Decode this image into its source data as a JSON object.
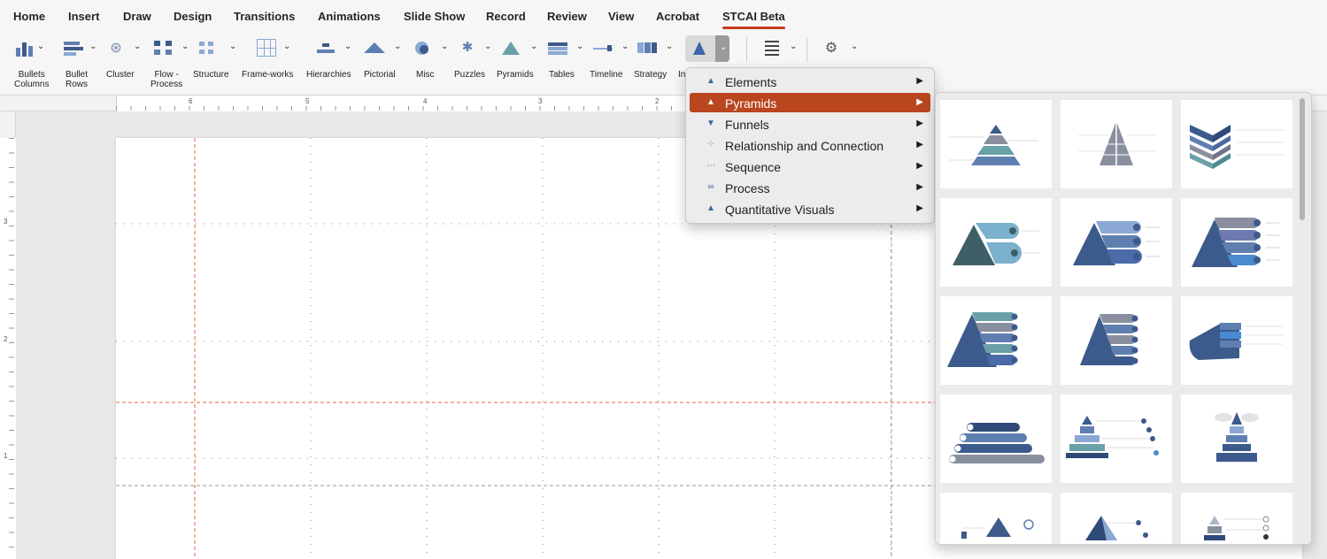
{
  "tabs": [
    {
      "label": "Home"
    },
    {
      "label": "Insert"
    },
    {
      "label": "Draw"
    },
    {
      "label": "Design"
    },
    {
      "label": "Transitions"
    },
    {
      "label": "Animations"
    },
    {
      "label": "Slide Show"
    },
    {
      "label": "Record"
    },
    {
      "label": "Review"
    },
    {
      "label": "View"
    },
    {
      "label": "Acrobat"
    },
    {
      "label": "STCAI Beta",
      "active": true
    }
  ],
  "ribbon": {
    "buttons": [
      {
        "label_1": "Bullets",
        "label_2": "Columns",
        "icon": "bullets-columns-icon"
      },
      {
        "label_1": "Bullet",
        "label_2": "Rows",
        "icon": "bullet-rows-icon"
      },
      {
        "label_1": "Cluster",
        "label_2": "",
        "icon": "cluster-icon"
      },
      {
        "label_1": "Flow -",
        "label_2": "Process",
        "icon": "flow-process-icon"
      },
      {
        "label_1": "Structure",
        "label_2": "",
        "icon": "structure-icon"
      },
      {
        "label_1": "Frame-works",
        "label_2": "",
        "icon": "frameworks-icon"
      },
      {
        "label_1": "Hierarchies",
        "label_2": "",
        "icon": "hierarchies-icon"
      },
      {
        "label_1": "Pictorial",
        "label_2": "",
        "icon": "pictorial-icon"
      },
      {
        "label_1": "Misc",
        "label_2": "",
        "icon": "misc-icon"
      },
      {
        "label_1": "Puzzles",
        "label_2": "",
        "icon": "puzzles-icon"
      },
      {
        "label_1": "Pyramids",
        "label_2": "",
        "icon": "pyramids-icon"
      },
      {
        "label_1": "Tables",
        "label_2": "",
        "icon": "tables-icon"
      },
      {
        "label_1": "Timeline",
        "label_2": "",
        "icon": "timeline-icon"
      },
      {
        "label_1": "Strategy",
        "label_2": "",
        "icon": "strategy-icon"
      },
      {
        "label_1": "In",
        "label_2": "",
        "icon": "infographics-icon"
      }
    ]
  },
  "ruler": {
    "top_numbers": [
      "6",
      "5",
      "4",
      "3",
      "2"
    ],
    "left_numbers": [
      "3",
      "2",
      "1"
    ]
  },
  "menu": {
    "items": [
      {
        "label": "Elements",
        "icon": "elements-icon",
        "selected": false
      },
      {
        "label": "Pyramids",
        "icon": "pyramid-icon",
        "selected": true
      },
      {
        "label": "Funnels",
        "icon": "funnel-icon",
        "selected": false
      },
      {
        "label": "Relationship and Connection",
        "icon": "relationship-icon",
        "selected": false
      },
      {
        "label": "Sequence",
        "icon": "sequence-icon",
        "selected": false
      },
      {
        "label": "Process",
        "icon": "process-icon",
        "selected": false
      },
      {
        "label": "Quantitative Visuals",
        "icon": "quantitative-icon",
        "selected": false
      }
    ]
  },
  "colors": {
    "accent": "#c43e1c",
    "selected_menu": "#b9461f",
    "pyramid_dark": "#3d5a8c",
    "pyramid_mid": "#5f7fb0",
    "pyramid_light": "#8ba8d4",
    "pyramid_teal": "#6aa0a8",
    "pyramid_grey": "#8a8fa0"
  }
}
